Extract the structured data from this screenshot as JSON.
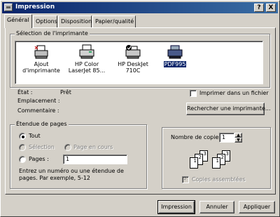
{
  "window": {
    "title": "Impression"
  },
  "titlebar_buttons": {
    "help": "?",
    "close": "X"
  },
  "tabs": [
    {
      "label": "Général"
    },
    {
      "label": "Options"
    },
    {
      "label": "Disposition"
    },
    {
      "label": "Papier/qualité"
    }
  ],
  "printer_group": {
    "title": "Sélection de l'imprimante",
    "printers": [
      {
        "line1": "Ajout",
        "line2": "d'imprimante",
        "icon": "add-printer-icon"
      },
      {
        "line1": "HP Color",
        "line2": "LaserJet 85...",
        "icon": "printer-icon"
      },
      {
        "line1": "HP DeskJet",
        "line2": "710C",
        "icon": "default-printer-icon"
      },
      {
        "line1": "PDF995",
        "line2": "",
        "icon": "printer-icon",
        "selected": true
      }
    ]
  },
  "status": {
    "state_label": "État :",
    "state_value": "Prêt",
    "location_label": "Emplacement :",
    "comment_label": "Commentaire :"
  },
  "print_to_file": {
    "label": "Imprimer dans un fichier",
    "checked": false
  },
  "find_printer_button": "Rechercher une imprimante...",
  "page_range": {
    "title": "Étendue de pages",
    "all": "Tout",
    "selection": "Sélection",
    "current_page": "Page en cours",
    "pages": "Pages :",
    "pages_value": "1",
    "hint": "Entrez un numéro ou une étendue de pages. Par exemple, 5-12"
  },
  "copies": {
    "label": "Nombre de copies :",
    "value": "1",
    "collate_label": "Copies assemblées",
    "collate_checked": true
  },
  "buttons": {
    "print": "Impression",
    "cancel": "Annuler",
    "apply": "Appliquer"
  }
}
